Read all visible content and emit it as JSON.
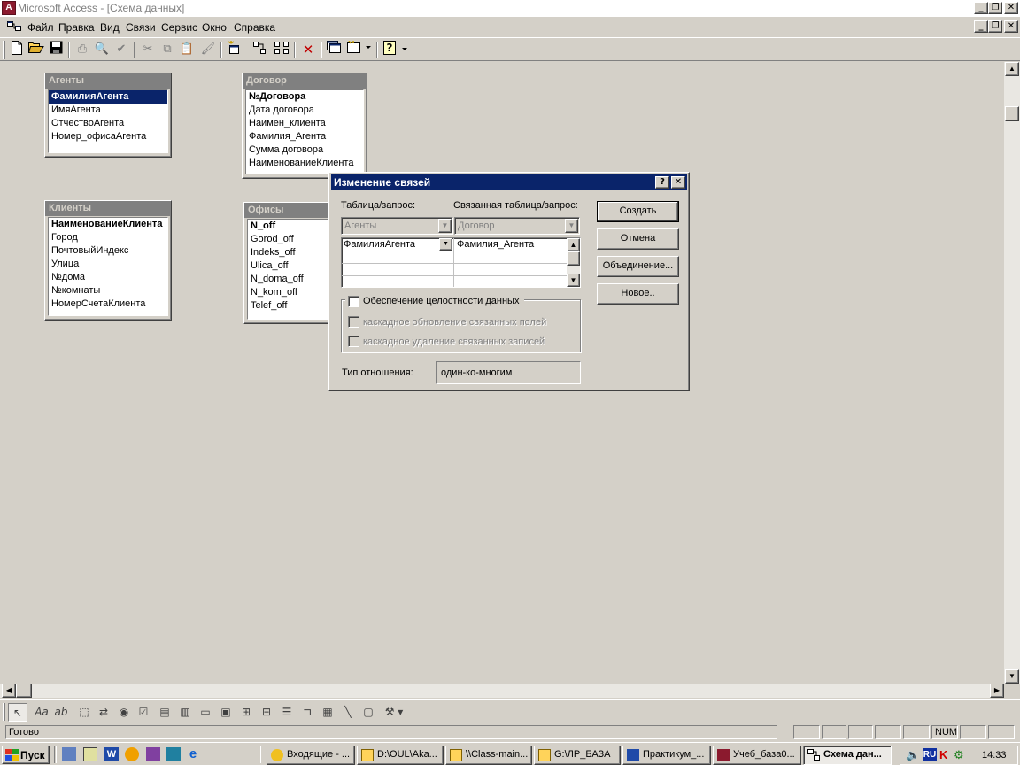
{
  "window": {
    "app_title": "Microsoft Access - [Схема данных]"
  },
  "menu": {
    "items": [
      "Файл",
      "Правка",
      "Вид",
      "Связи",
      "Сервис",
      "Окно",
      "Справка"
    ]
  },
  "tables": {
    "agents": {
      "title": "Агенты",
      "fields": [
        "ФамилияАгента",
        "ИмяАгента",
        "ОтчествоАгента",
        "Номер_офисаАгента"
      ]
    },
    "contract": {
      "title": "Договор",
      "fields": [
        "№Договора",
        "Дата договора",
        "Наимен_клиента",
        "Фамилия_Агента",
        "Сумма договора",
        "НаименованиеКлиента"
      ]
    },
    "clients": {
      "title": "Клиенты",
      "fields": [
        "НаименованиеКлиента",
        "Город",
        "ПочтовыйИндекс",
        "Улица",
        "№дома",
        "№комнаты",
        "НомерСчетаКлиента"
      ]
    },
    "offices": {
      "title": "Офисы",
      "fields": [
        "N_off",
        "Gorod_off",
        "Indeks_off",
        "Ulica_off",
        "N_doma_off",
        "N_kom_off",
        "Telef_off"
      ]
    }
  },
  "dialog": {
    "title": "Изменение связей",
    "help_btn": "?",
    "close_btn": "✕",
    "table_label": "Таблица/запрос:",
    "related_label": "Связанная таблица/запрос:",
    "table_value": "Агенты",
    "related_value": "Договор",
    "grid_left_1": "ФамилияАгента",
    "grid_right_1": "Фамилия_Агента",
    "buttons": {
      "create": "Создать",
      "cancel": "Отмена",
      "join": "Объединение...",
      "new": "Новое.."
    },
    "integrity_label": "Обеспечение целостности данных",
    "cascade_update": "каскадное обновление связанных полей",
    "cascade_delete": "каскадное удаление связанных записей",
    "rel_type_label": "Тип отношения:",
    "rel_type_value": "один-ко-многим"
  },
  "statusbar": {
    "text": "Готово",
    "num": "NUM"
  },
  "taskbar": {
    "start": "Пуск",
    "tasks": [
      "Входящие - ...",
      "D:\\OUL\\Aka...",
      "\\\\Class-main...",
      "G:\\ЛР_БАЗА",
      "Практикум_...",
      "Учеб_база0...",
      "Схема дан..."
    ],
    "lang": "RU",
    "clock": "14:33"
  },
  "icons": {
    "toolbar": [
      "new-icon",
      "open-icon",
      "save-icon",
      "print-icon",
      "print-preview-icon",
      "spelling-icon",
      "cut-icon",
      "copy-icon",
      "paste-icon",
      "format-painter-icon",
      "show-table-icon",
      "show-direct-icon",
      "show-all-icon",
      "delete-icon",
      "database-window-icon",
      "new-object-icon",
      "help-icon"
    ]
  },
  "colors": {
    "face": "#d4d0c8",
    "active_title": "#0a246a",
    "inactive_title": "#808080"
  }
}
